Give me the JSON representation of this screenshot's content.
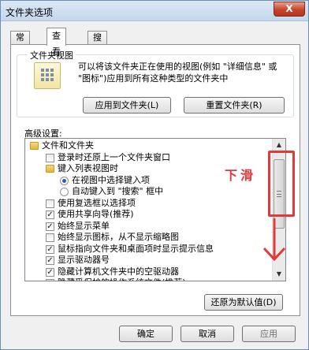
{
  "window": {
    "title": "文件夹选项",
    "close_glyph": "X"
  },
  "tabs": [
    {
      "label": "常规",
      "active": false
    },
    {
      "label": "查看",
      "active": true
    },
    {
      "label": "搜索",
      "active": false
    }
  ],
  "folder_views": {
    "title": "文件夹视图",
    "description": "可以将该文件夹正在使用的视图(例如 \"详细信息\" 或 \"图标\")应用到所有这种类型的文件夹中",
    "apply_button": "应用到文件夹(L)",
    "reset_button": "重置文件夹(R)"
  },
  "advanced": {
    "label": "高级设置:",
    "items": [
      {
        "type": "folder",
        "level": 0,
        "label": "文件和文件夹"
      },
      {
        "type": "checkbox",
        "level": 1,
        "checked": false,
        "label": "登录时还原上一个文件夹窗口"
      },
      {
        "type": "folder",
        "level": 1,
        "label": "键入列表视图时"
      },
      {
        "type": "radio",
        "level": 2,
        "checked": true,
        "label": "在视图中选择键入项"
      },
      {
        "type": "radio",
        "level": 2,
        "checked": false,
        "label": "自动键入到 \"搜索\" 框中"
      },
      {
        "type": "checkbox",
        "level": 1,
        "checked": false,
        "label": "使用复选框以选择项"
      },
      {
        "type": "checkbox",
        "level": 1,
        "checked": true,
        "label": "使用共享向导(推荐)"
      },
      {
        "type": "checkbox",
        "level": 1,
        "checked": true,
        "label": "始终显示菜单"
      },
      {
        "type": "checkbox",
        "level": 1,
        "checked": false,
        "label": "始终显示图标，从不显示缩略图"
      },
      {
        "type": "checkbox",
        "level": 1,
        "checked": true,
        "label": "鼠标指向文件夹和桌面项时显示提示信息"
      },
      {
        "type": "checkbox",
        "level": 1,
        "checked": true,
        "label": "显示驱动器号"
      },
      {
        "type": "checkbox",
        "level": 1,
        "checked": true,
        "label": "隐藏计算机文件夹中的空驱动器"
      },
      {
        "type": "checkbox",
        "level": 1,
        "checked": true,
        "label": "隐藏受保护的操作系统文件(推荐)"
      }
    ],
    "restore_defaults": "还原为默认值(D)"
  },
  "annotation": {
    "text": "下滑",
    "color": "#e23a3a"
  },
  "buttons": {
    "ok": "确定",
    "cancel": "取消",
    "apply": "应用"
  }
}
